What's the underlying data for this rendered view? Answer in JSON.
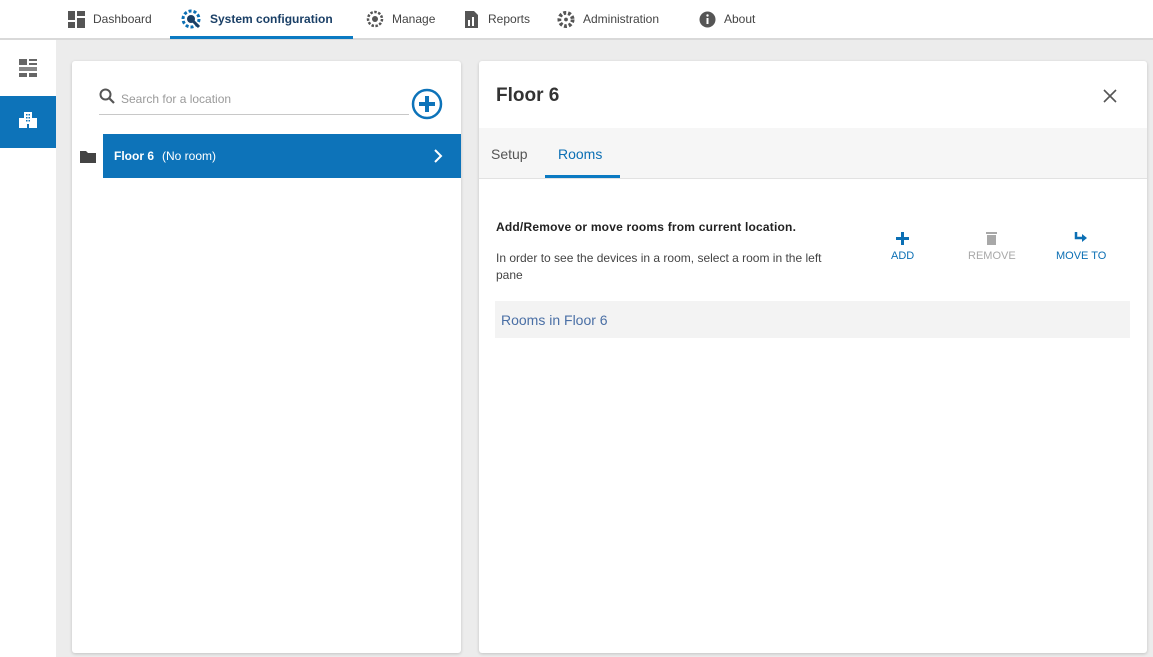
{
  "nav": {
    "items": [
      {
        "label": "Dashboard",
        "icon": "dashboard-icon"
      },
      {
        "label": "System configuration",
        "icon": "system-config-icon"
      },
      {
        "label": "Manage",
        "icon": "manage-gear-icon"
      },
      {
        "label": "Reports",
        "icon": "reports-icon"
      },
      {
        "label": "Administration",
        "icon": "admin-gear-icon"
      },
      {
        "label": "About",
        "icon": "info-icon"
      }
    ],
    "active": "System configuration"
  },
  "rail": {
    "items": [
      {
        "icon": "devices-icon",
        "active": false
      },
      {
        "icon": "building-icon",
        "active": true
      }
    ]
  },
  "left_panel": {
    "search": {
      "placeholder": "Search for a location",
      "value": ""
    },
    "add_icon": "add-circle-icon",
    "tree": [
      {
        "name": "Floor 6",
        "note": "(No room)",
        "selected": true,
        "icon": "folder-icon"
      }
    ]
  },
  "right_panel": {
    "title": "Floor 6",
    "tabs": [
      {
        "label": "Setup",
        "active": false
      },
      {
        "label": "Rooms",
        "active": true
      }
    ],
    "description_title": "Add/Remove or move rooms from current location.",
    "description_text": "In order to see the devices in a room, select a room in the left pane",
    "actions": [
      {
        "label": "ADD",
        "icon": "plus-icon",
        "enabled": true
      },
      {
        "label": "REMOVE",
        "icon": "trash-icon",
        "enabled": false
      },
      {
        "label": "MOVE TO",
        "icon": "move-arrow-icon",
        "enabled": true
      }
    ],
    "rooms_header": "Rooms in Floor 6"
  },
  "colors": {
    "accent": "#0d73b9",
    "background": "#ececec",
    "disabled": "#a8a8a8"
  }
}
